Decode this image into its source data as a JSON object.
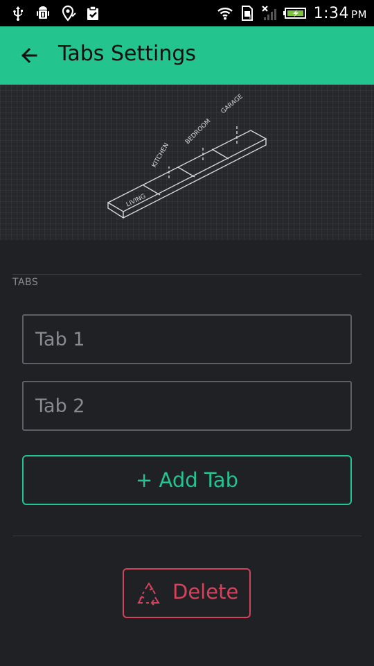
{
  "status_bar": {
    "time": "1:34",
    "ampm": "PM",
    "icons": [
      "usb-icon",
      "android-debug-icon",
      "location-pin-icon",
      "clipboard-check-icon",
      "wifi-icon",
      "sim-icon",
      "no-signal-icon",
      "battery-charging-icon"
    ]
  },
  "app_bar": {
    "title": "Tabs Settings",
    "back_icon": "arrow-left-icon",
    "background": "#23c48e"
  },
  "illustration": {
    "labels": [
      "LIVING",
      "KITCHEN",
      "BEDROOM",
      "GARAGE"
    ]
  },
  "tabs_section": {
    "label": "TABS",
    "fields": [
      {
        "value": "Tab 1"
      },
      {
        "value": "Tab 2"
      }
    ],
    "add_button_label": "+ Add Tab"
  },
  "delete": {
    "label": "Delete",
    "icon": "recycle-icon",
    "color": "#d3435c"
  },
  "colors": {
    "accent": "#23c48e",
    "background": "#202125",
    "danger": "#d3435c"
  }
}
